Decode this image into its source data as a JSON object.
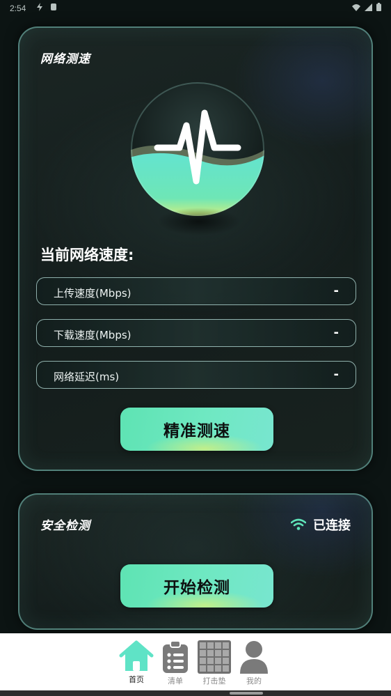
{
  "status_bar": {
    "time": "2:54"
  },
  "speed_card": {
    "title": "网络测速",
    "heading": "当前网络速度:",
    "metrics": [
      {
        "label": "上传速度(Mbps)",
        "value": "-"
      },
      {
        "label": "下载速度(Mbps)",
        "value": "-"
      },
      {
        "label": "网络延迟(ms)",
        "value": "-"
      }
    ],
    "button_label": "精准测速"
  },
  "security_card": {
    "title": "安全检测",
    "status": "已连接",
    "button_label": "开始检测"
  },
  "bottom_nav": {
    "items": [
      {
        "label": "首页",
        "icon": "home-icon",
        "active": true
      },
      {
        "label": "清单",
        "icon": "clipboard-list-icon",
        "active": false
      },
      {
        "label": "打击垫",
        "icon": "grid-icon",
        "active": false
      },
      {
        "label": "我的",
        "icon": "person-icon",
        "active": false
      }
    ]
  },
  "colors": {
    "accent": "#5fe3b8",
    "card_border": "#82cdc3",
    "background": "#0c1413"
  }
}
